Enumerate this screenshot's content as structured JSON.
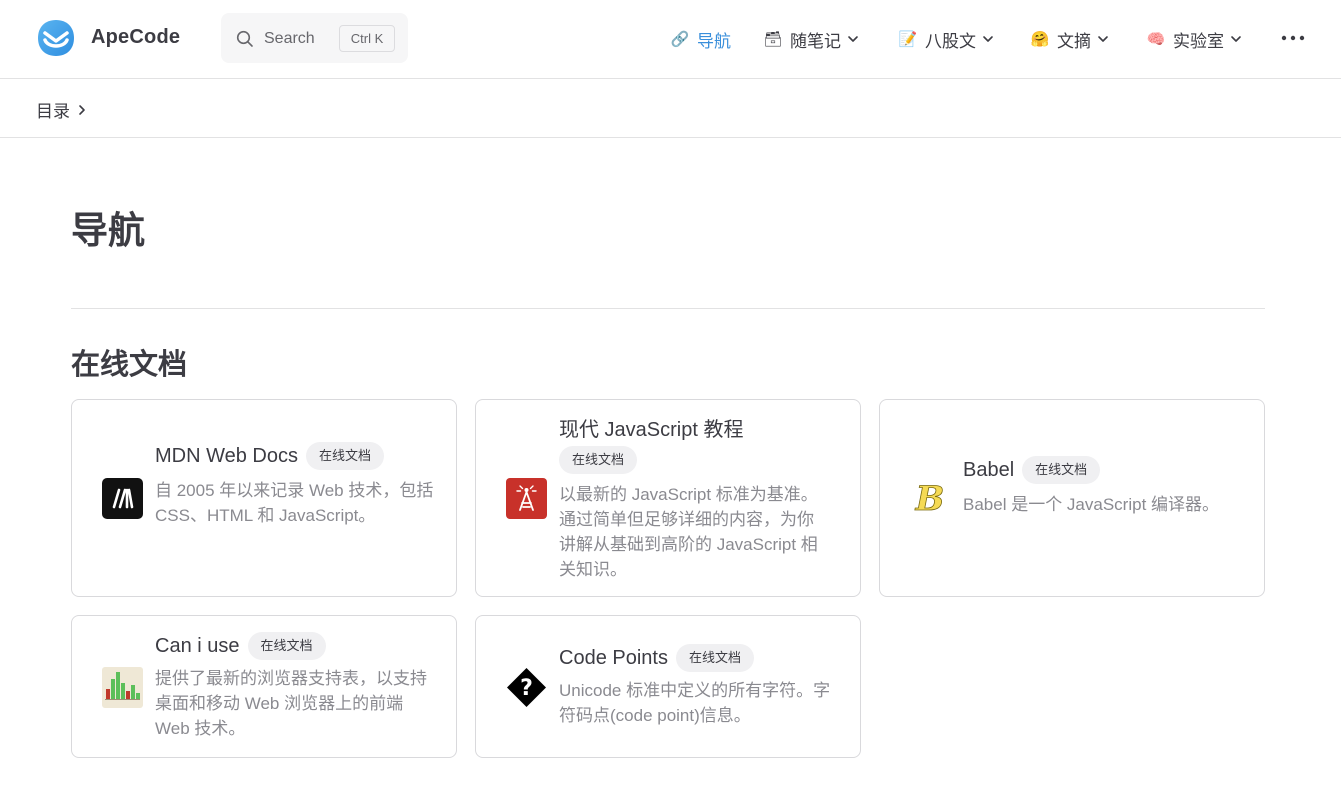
{
  "brand": {
    "name": "ApeCode"
  },
  "search": {
    "label": "Search",
    "shortcut": "Ctrl K"
  },
  "nav": [
    {
      "emoji": "🔗",
      "label": "导航",
      "active": true
    },
    {
      "emoji": "🗃",
      "label": "随笔记"
    },
    {
      "emoji": "📝",
      "label": "八股文"
    },
    {
      "emoji": "🤗",
      "label": "文摘"
    },
    {
      "emoji": "🧠",
      "label": "实验室"
    }
  ],
  "breadcrumb": {
    "label": "目录"
  },
  "page": {
    "title": "导航"
  },
  "section": {
    "title": "在线文档"
  },
  "cards": [
    {
      "name": "MDN Web Docs",
      "tag": "在线文档",
      "desc": "自 2005 年以来记录 Web 技术，包括 CSS、HTML 和 JavaScript。",
      "icon": "mdn-logo-icon"
    },
    {
      "name": "现代 JavaScript 教程",
      "tag": "在线文档",
      "desc": "以最新的 JavaScript 标准为基准。通过简单但足够详细的内容，为你讲解从基础到高阶的 JavaScript 相关知识。",
      "icon": "javascript-info-logo-icon"
    },
    {
      "name": "Babel",
      "tag": "在线文档",
      "desc": "Babel 是一个 JavaScript 编译器。",
      "icon": "babel-logo-icon"
    },
    {
      "name": "Can i use",
      "tag": "在线文档",
      "desc": "提供了最新的浏览器支持表，以支持桌面和移动 Web 浏览器上的前端 Web 技术。",
      "icon": "caniuse-logo-icon"
    },
    {
      "name": "Code Points",
      "tag": "在线文档",
      "desc": "Unicode 标准中定义的所有字符。字符码点(code point)信息。",
      "icon": "codepoints-logo-icon"
    }
  ],
  "colors": {
    "accent": "#3a8fdb",
    "text": "#3c3c43",
    "muted": "#8a8a90",
    "border": "#d9d9dc"
  }
}
